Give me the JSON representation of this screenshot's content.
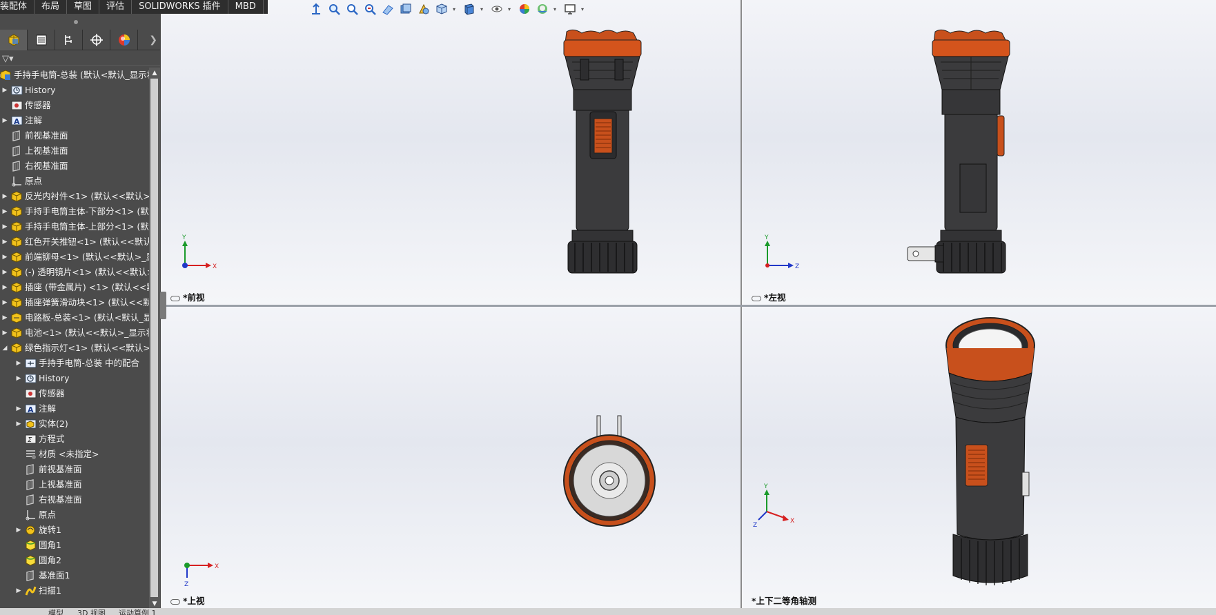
{
  "command_tabs": [
    "装配体",
    "布局",
    "草图",
    "评估",
    "SOLIDWORKS 插件",
    "MBD"
  ],
  "colors": {
    "flashlight_body": "#3b3b3d",
    "flashlight_head": "#d4541c",
    "axis_x": "#d62020",
    "axis_y": "#1a9a2a",
    "axis_z": "#2038c8",
    "panel_bg": "#4b4b4b"
  },
  "manager_tabs": [
    {
      "icon": "feature-manager-icon"
    },
    {
      "icon": "property-manager-icon"
    },
    {
      "icon": "configuration-manager-icon"
    },
    {
      "icon": "dimxpert-manager-icon"
    },
    {
      "icon": "display-manager-icon"
    }
  ],
  "tree": [
    {
      "label": "手持手电筒-总装 (默认<默认_显示状",
      "icon": "assembly-icon",
      "level": 0,
      "exp": "down"
    },
    {
      "label": "History",
      "icon": "history-icon",
      "level": 1,
      "exp": "right"
    },
    {
      "label": "传感器",
      "icon": "sensor-icon",
      "level": 1,
      "exp": ""
    },
    {
      "label": "注解",
      "icon": "annotation-icon",
      "level": 1,
      "exp": "right"
    },
    {
      "label": "前视基准面",
      "icon": "plane-icon",
      "level": 1,
      "exp": ""
    },
    {
      "label": "上视基准面",
      "icon": "plane-icon",
      "level": 1,
      "exp": ""
    },
    {
      "label": "右视基准面",
      "icon": "plane-icon",
      "level": 1,
      "exp": ""
    },
    {
      "label": "原点",
      "icon": "origin-icon",
      "level": 1,
      "exp": ""
    },
    {
      "label": "反光内衬件<1> (默认<<默认>_",
      "icon": "part-icon",
      "level": 1,
      "exp": "right"
    },
    {
      "label": "手持手电筒主体-下部分<1> (默认",
      "icon": "part-icon",
      "level": 1,
      "exp": "right"
    },
    {
      "label": "手持手电筒主体-上部分<1> (默认",
      "icon": "part-icon",
      "level": 1,
      "exp": "right"
    },
    {
      "label": "红色开关推钮<1> (默认<<默认>",
      "icon": "part-icon",
      "level": 1,
      "exp": "right"
    },
    {
      "label": "前端铆母<1> (默认<<默认>_显",
      "icon": "part-icon",
      "level": 1,
      "exp": "right"
    },
    {
      "label": "(-) 透明镜片<1> (默认<<默认>_",
      "icon": "part-icon",
      "level": 1,
      "exp": "right"
    },
    {
      "label": "插座 (带金属片) <1> (默认<<默",
      "icon": "part-icon",
      "level": 1,
      "exp": "right"
    },
    {
      "label": "插座弹簧滑动块<1> (默认<<默认",
      "icon": "part-icon",
      "level": 1,
      "exp": "right"
    },
    {
      "label": "电路板-总装<1> (默认<默认_显",
      "icon": "subassembly-icon",
      "level": 1,
      "exp": "right"
    },
    {
      "label": "电池<1> (默认<<默认>_显示状",
      "icon": "part-icon",
      "level": 1,
      "exp": "right"
    },
    {
      "label": "绿色指示灯<1> (默认<<默认>_",
      "icon": "part-icon",
      "level": 1,
      "exp": "down"
    },
    {
      "label": "手持手电筒-总装 中的配合",
      "icon": "mates-icon",
      "level": 2,
      "exp": "right"
    },
    {
      "label": "History",
      "icon": "history-icon",
      "level": 2,
      "exp": "right"
    },
    {
      "label": "传感器",
      "icon": "sensor-icon",
      "level": 2,
      "exp": ""
    },
    {
      "label": "注解",
      "icon": "annotation-icon",
      "level": 2,
      "exp": "right"
    },
    {
      "label": "实体(2)",
      "icon": "solid-bodies-icon",
      "level": 2,
      "exp": "right"
    },
    {
      "label": "方程式",
      "icon": "equation-icon",
      "level": 2,
      "exp": ""
    },
    {
      "label": "材质 <未指定>",
      "icon": "material-icon",
      "level": 2,
      "exp": ""
    },
    {
      "label": "前视基准面",
      "icon": "plane-icon",
      "level": 2,
      "exp": ""
    },
    {
      "label": "上视基准面",
      "icon": "plane-icon",
      "level": 2,
      "exp": ""
    },
    {
      "label": "右视基准面",
      "icon": "plane-icon",
      "level": 2,
      "exp": ""
    },
    {
      "label": "原点",
      "icon": "origin-icon",
      "level": 2,
      "exp": ""
    },
    {
      "label": "旋转1",
      "icon": "revolve-icon",
      "level": 2,
      "exp": "right"
    },
    {
      "label": "圆角1",
      "icon": "fillet-icon",
      "level": 2,
      "exp": ""
    },
    {
      "label": "圆角2",
      "icon": "fillet-icon",
      "level": 2,
      "exp": ""
    },
    {
      "label": "基准面1",
      "icon": "plane-icon",
      "level": 2,
      "exp": ""
    },
    {
      "label": "扫描1",
      "icon": "sweep-icon",
      "level": 2,
      "exp": "right"
    }
  ],
  "viewports": {
    "front": {
      "label": "*前视",
      "axes": [
        "Y",
        "X"
      ]
    },
    "left": {
      "label": "*左视",
      "axes": [
        "Y",
        "Z"
      ]
    },
    "top": {
      "label": "*上视",
      "axes": [
        "Z",
        "X"
      ]
    },
    "iso": {
      "label": "*上下二等角轴测",
      "axes": [
        "Y",
        "Z",
        "X"
      ]
    }
  },
  "bottom_tabs": [
    "模型",
    "3D 视图",
    "运动算例 1"
  ],
  "heads_up_toolbar": [
    "view-orientation-icon",
    "zoom-to-fit-icon",
    "zoom-to-area-icon",
    "previous-view-icon",
    "section-view-icon",
    "dynamic-annotation-icon",
    "view-settings-icon",
    "view-orientation-cube-icon",
    "display-style-icon",
    "hide-show-icon",
    "edit-appearance-icon",
    "apply-scene-icon",
    "monitor-icon"
  ]
}
